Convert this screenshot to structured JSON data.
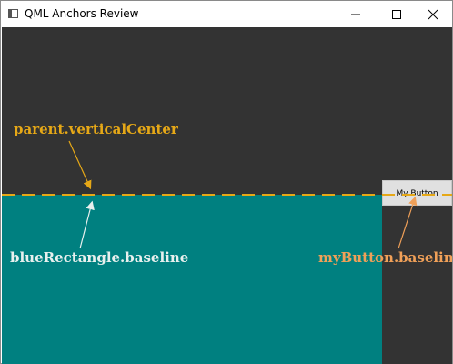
{
  "window": {
    "title": "QML Anchors Review",
    "controls": [
      "minimize-icon",
      "maximize-icon",
      "close-icon"
    ]
  },
  "scene": {
    "colors": {
      "background": "#333333",
      "blue_rectangle": "#008080",
      "center_line": "#e6a817",
      "button_face": "#e0e0e0"
    },
    "button": {
      "label": "My Button"
    },
    "annotations": {
      "vertical_center": "parent.verticalCenter",
      "blue_baseline": "blueRectangle.baseline",
      "button_baseline": "myButton.baseline"
    }
  }
}
